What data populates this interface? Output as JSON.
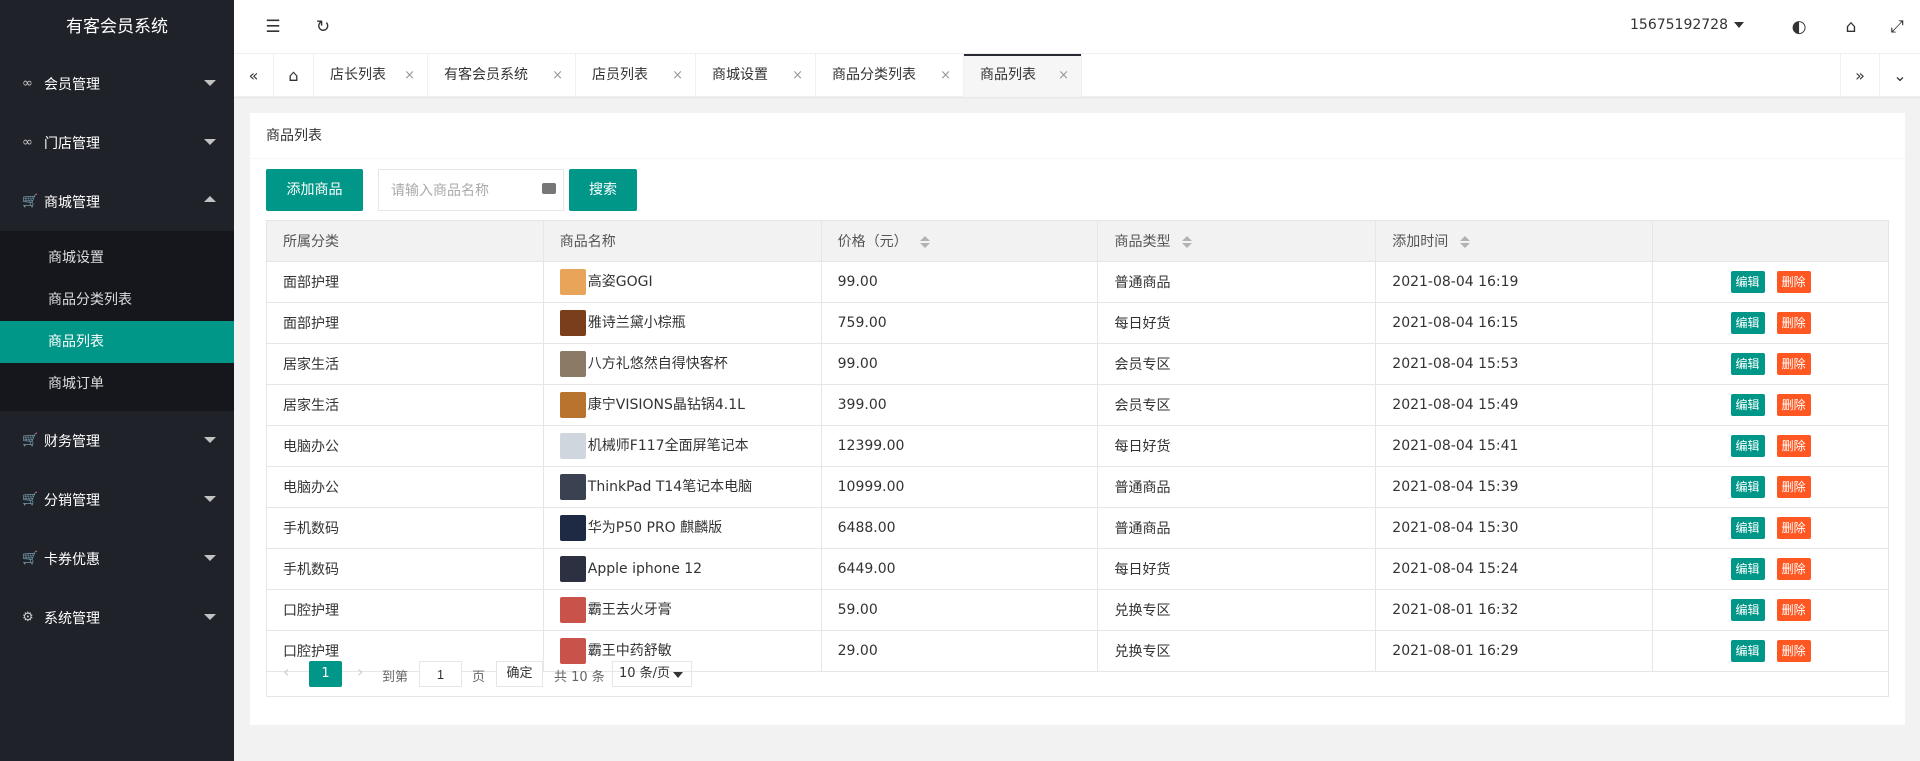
{
  "sidebar": {
    "logo": "有客会员系统",
    "items": [
      {
        "label": "会员管理",
        "icon": "∞"
      },
      {
        "label": "门店管理",
        "icon": "∞"
      },
      {
        "label": "商城管理",
        "icon": "🛒"
      },
      {
        "label": "财务管理",
        "icon": "🛒"
      },
      {
        "label": "分销管理",
        "icon": "🛒"
      },
      {
        "label": "卡券优惠",
        "icon": "🛒"
      },
      {
        "label": "系统管理",
        "icon": "⚙"
      }
    ],
    "subitems": [
      "商城设置",
      "商品分类列表",
      "商品列表",
      "商城订单"
    ]
  },
  "header": {
    "user": "15675192728",
    "icons": [
      "menu-icon",
      "refresh-icon",
      "theme-icon",
      "tag-icon",
      "fullscreen-icon"
    ]
  },
  "tabs": [
    {
      "label": "店长列表"
    },
    {
      "label": "有客会员系统"
    },
    {
      "label": "店员列表"
    },
    {
      "label": "商城设置"
    },
    {
      "label": "商品分类列表"
    },
    {
      "label": "商品列表"
    }
  ],
  "main": {
    "title": "商品列表",
    "add_button": "添加商品",
    "search_placeholder": "请输入商品名称",
    "search_button": "搜索",
    "columns": [
      "所属分类",
      "商品名称",
      "价格（元）",
      "商品类型",
      "添加时间",
      ""
    ],
    "rows": [
      {
        "category": "面部护理",
        "name": "高姿GOGI",
        "price": "99.00",
        "type": "普通商品",
        "time": "2021-08-04 16:19",
        "thumb": "#e8a55a"
      },
      {
        "category": "面部护理",
        "name": "雅诗兰黛小棕瓶",
        "price": "759.00",
        "type": "每日好货",
        "time": "2021-08-04 16:15",
        "thumb": "#7a3e1c"
      },
      {
        "category": "居家生活",
        "name": "八方礼悠然自得快客杯",
        "price": "99.00",
        "type": "会员专区",
        "time": "2021-08-04 15:53",
        "thumb": "#8a7a66"
      },
      {
        "category": "居家生活",
        "name": "康宁VISIONS晶钻锅4.1L",
        "price": "399.00",
        "type": "会员专区",
        "time": "2021-08-04 15:49",
        "thumb": "#b8742e"
      },
      {
        "category": "电脑办公",
        "name": "机械师F117全面屏笔记本",
        "price": "12399.00",
        "type": "每日好货",
        "time": "2021-08-04 15:41",
        "thumb": "#cfd6de"
      },
      {
        "category": "电脑办公",
        "name": "ThinkPad T14笔记本电脑",
        "price": "10999.00",
        "type": "普通商品",
        "time": "2021-08-04 15:39",
        "thumb": "#3a4150"
      },
      {
        "category": "手机数码",
        "name": "华为P50 PRO 麒麟版",
        "price": "6488.00",
        "type": "普通商品",
        "time": "2021-08-04 15:30",
        "thumb": "#1e2a44"
      },
      {
        "category": "手机数码",
        "name": "Apple iphone 12",
        "price": "6449.00",
        "type": "每日好货",
        "time": "2021-08-04 15:24",
        "thumb": "#2c3040"
      },
      {
        "category": "口腔护理",
        "name": "霸王去火牙膏",
        "price": "59.00",
        "type": "兑换专区",
        "time": "2021-08-01 16:32",
        "thumb": "#c9524a"
      },
      {
        "category": "口腔护理",
        "name": "霸王中药舒敏",
        "price": "29.00",
        "type": "兑换专区",
        "time": "2021-08-01 16:29",
        "thumb": "#c9524a"
      }
    ],
    "edit_label": "编辑",
    "delete_label": "删除"
  },
  "pager": {
    "current": "1",
    "goto_label": "到第",
    "page_input": "1",
    "page_label": "页",
    "confirm": "确定",
    "total": "共 10 条",
    "per_page": "10 条/页"
  },
  "colors": {
    "primary": "#009688",
    "danger": "#ff5722",
    "sidebar": "#20222a"
  }
}
